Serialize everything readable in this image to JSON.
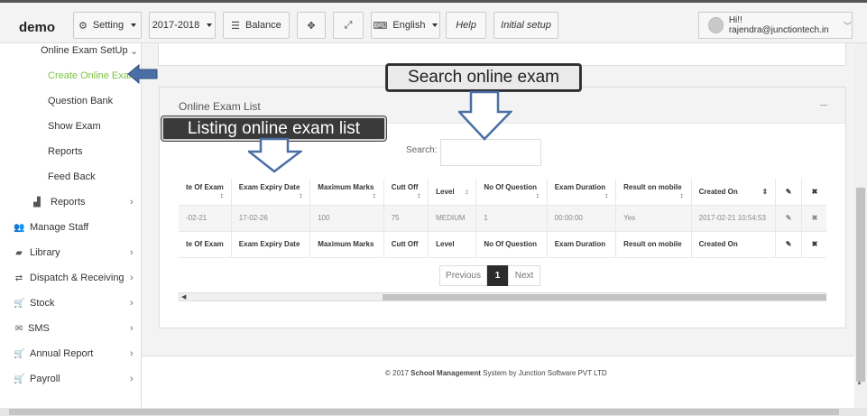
{
  "brand": "demo",
  "toolbar": {
    "setting": "Setting",
    "year": "2017-2018",
    "balance": "Balance",
    "language": "English",
    "help": "Help",
    "initial_setup": "Initial setup",
    "user": "Hi!! rajendra@junctiontech.in"
  },
  "sidebar": {
    "group": "Online Exam SetUp",
    "subitems": [
      "Create Online Exam",
      "Question Bank",
      "Show Exam",
      "Reports",
      "Feed Back"
    ],
    "reports": "Reports",
    "items": [
      "Manage Staff",
      "Library",
      "Dispatch & Receiving",
      "Stock",
      "SMS",
      "Annual Report",
      "Payroll"
    ]
  },
  "panel": {
    "title": "Online Exam List",
    "search_label": "Search:"
  },
  "table": {
    "headers": [
      "te Of Exam",
      "Exam Expiry Date",
      "Maximum Marks",
      "Cutt Off",
      "Level",
      "No Of Question",
      "Exam Duration",
      "Result on mobile",
      "Created On"
    ],
    "footers": [
      "te Of Exam",
      "Exam Expiry Date",
      "Maximum Marks",
      "Cutt Off",
      "Level",
      "No Of Question",
      "Exam Duration",
      "Result on mobile",
      "Created On"
    ],
    "row": [
      "-02-21",
      "17-02-26",
      "100",
      "75",
      "MEDIUM",
      "1",
      "00:00:00",
      "Yes",
      "2017-02-21 10:54:53"
    ]
  },
  "pager": {
    "previous": "Previous",
    "page": "1",
    "next": "Next"
  },
  "footer": {
    "prefix": "© 2017 ",
    "bold": "School Management",
    "suffix": " System by Junction Software PVT LTD"
  },
  "callouts": {
    "search": "Search online exam",
    "listing": "Listing online exam list"
  },
  "colors": {
    "active": "#7cc242",
    "arrow": "#4a6fa5"
  },
  "icons": [
    "gear-icon",
    "database-icon",
    "fullscreen-icon",
    "expand-icon",
    "language-icon",
    "users-icon",
    "book-icon",
    "exchange-icon",
    "cart-icon",
    "envelope-icon",
    "bar-chart-icon",
    "edit-icon",
    "delete-icon"
  ]
}
